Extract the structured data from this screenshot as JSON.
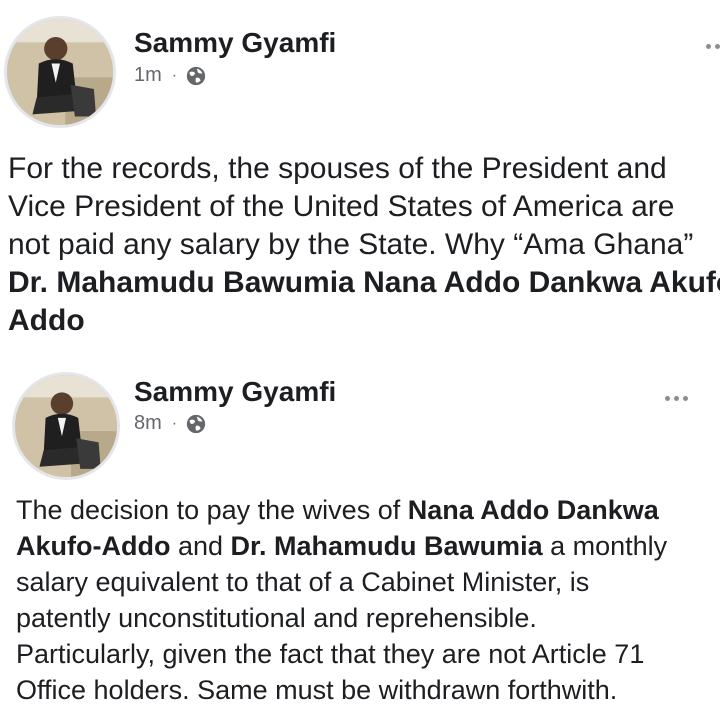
{
  "posts": [
    {
      "author": "Sammy Gyamfi",
      "time": "1m",
      "separator": "·",
      "text_lines": [
        "For the records, the spouses of the President and",
        "Vice President of the United States of America are",
        "not paid any salary by the State. Why “Ama Ghana”"
      ],
      "bold_lines": [
        "Dr. Mahamudu Bawumia Nana Addo Dankwa Akufo",
        "Addo"
      ]
    },
    {
      "author": "Sammy Gyamfi",
      "time": "8m",
      "separator": "·",
      "text_segments": {
        "s1": "The decision to pay the wives of ",
        "s2_bold": "Nana Addo Dankwa",
        "s3_bold": "Akufo-Addo",
        "s4": " and ",
        "s5_bold": "Dr. Mahamudu Bawumia",
        "s6": " a monthly",
        "l3": "salary equivalent to that of a Cabinet Minister, is",
        "l4": "patently unconstitutional and reprehensible.",
        "l5": "Particularly, given the fact that they are not Article 71",
        "l6": "Office holders. Same must be withdrawn forthwith."
      }
    }
  ],
  "icons": {
    "privacy": "globe-icon",
    "menu": "more-options-icon"
  },
  "colors": {
    "text": "#1c1e21",
    "meta": "#65676b",
    "dots": "#8a8d91"
  }
}
